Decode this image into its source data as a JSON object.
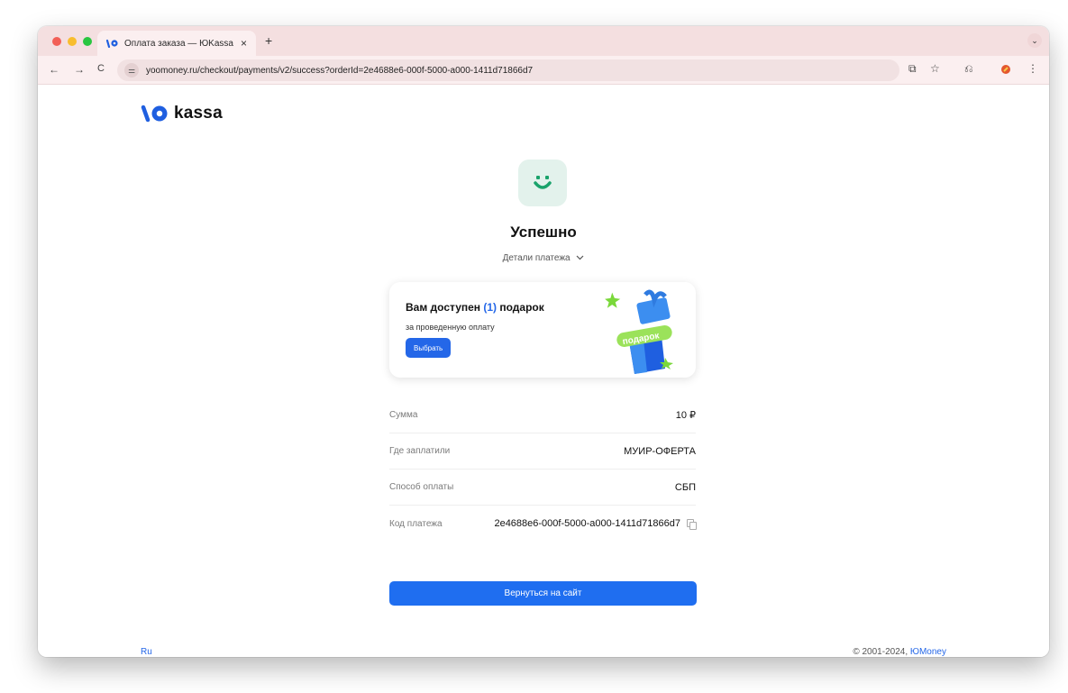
{
  "browser": {
    "tab_title": "Оплата заказа — ЮKassa",
    "tab_close": "×",
    "new_tab": "+",
    "tab_menu": "⌄",
    "url": "yoomoney.ru/checkout/payments/v2/success?orderId=2e4688e6-000f-5000-a000-1411d71866d7",
    "back": "←",
    "forward": "→",
    "reload": "C",
    "site_info": "⚌",
    "cast": "⧉",
    "bookmark": "☆",
    "extensions": "⎌",
    "menu": "⋮"
  },
  "page": {
    "logo_text": "kassa",
    "title": "Успешно",
    "details_label": "Детали платежа",
    "gift": {
      "title_prefix": "Вам доступен ",
      "count": "(1)",
      "title_suffix": " подарок",
      "subtitle": "за проведенную оплату",
      "button": "Выбрать",
      "sticker": "подарок"
    },
    "rows": [
      {
        "label": "Сумма",
        "value": "10 ₽"
      },
      {
        "label": "Где заплатили",
        "value": "МУИР-ОФЕРТА"
      },
      {
        "label": "Способ оплаты",
        "value": "СБП"
      },
      {
        "label": "Код платежа",
        "value": "2e4688e6-000f-5000-a000-1411d71866d7"
      }
    ],
    "return_button": "Вернуться на сайт",
    "language": "Ru",
    "copyright_prefix": "© 2001-2024, ",
    "copyright_brand": "ЮMoney"
  },
  "colors": {
    "accent": "#2467e8",
    "success_bg": "#e3f2ec",
    "success_icon": "#1aa36b",
    "tabstrip": "#f4dfe0"
  },
  "icons": {
    "logo": "yookassa-logo-icon",
    "success": "smile-icon",
    "copy": "copy-icon",
    "chevron": "chevron-down-icon"
  }
}
